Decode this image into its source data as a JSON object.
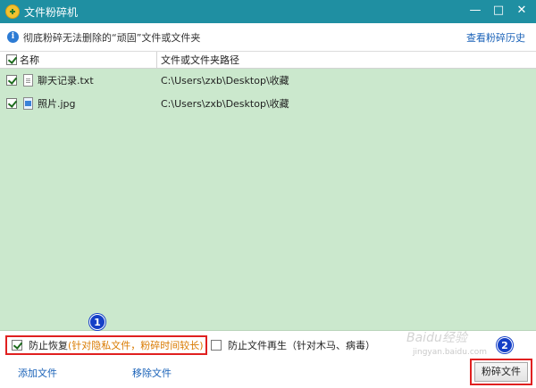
{
  "window": {
    "title": "文件粉碎机",
    "minimize": "—",
    "maximize": "□",
    "close": "✕"
  },
  "info": {
    "text": "彻底粉碎无法删除的“顽固”文件或文件夹",
    "history_link": "查看粉碎历史"
  },
  "table": {
    "columns": {
      "name": "名称",
      "path": "文件或文件夹路径"
    },
    "rows": [
      {
        "name": "聊天记录.txt",
        "path": "C:\\Users\\zxb\\Desktop\\收藏",
        "checked": true,
        "icon": "text-file-icon"
      },
      {
        "name": "照片.jpg",
        "path": "C:\\Users\\zxb\\Desktop\\收藏",
        "checked": true,
        "icon": "image-file-icon"
      }
    ]
  },
  "options": {
    "prevent_recovery": "防止恢复",
    "prevent_recovery_note": "(针对隐私文件，粉碎时间较长)",
    "prevent_regen": "防止文件再生（针对木马、病毒）"
  },
  "actions": {
    "add_file": "添加文件",
    "remove_file": "移除文件",
    "shred_file": "粉碎文件"
  },
  "badges": {
    "one": "1",
    "two": "2"
  },
  "watermark": {
    "main": "Baidu经验",
    "sub": "jingyan.baidu.com"
  },
  "colors": {
    "titlebar": "#1f8fa2",
    "list_bg": "#cbe8cd",
    "highlight": "#e02020",
    "badge": "#1540c7",
    "link": "#1a62b8",
    "note": "#d97a00"
  }
}
